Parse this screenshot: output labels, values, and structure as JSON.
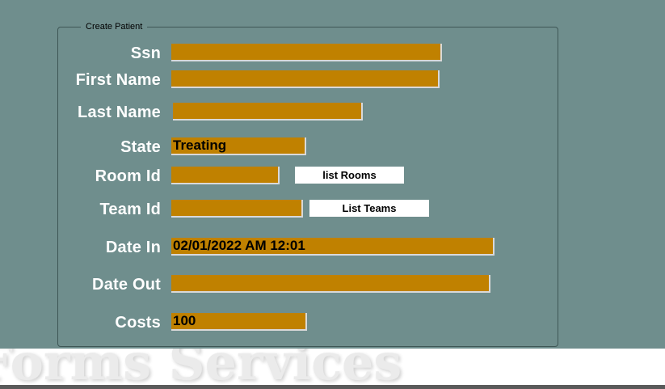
{
  "form": {
    "legend": "Create Patient",
    "fields": {
      "ssn": {
        "label": "Ssn",
        "value": ""
      },
      "first_name": {
        "label": "First Name",
        "value": ""
      },
      "last_name": {
        "label": "Last Name",
        "value": ""
      },
      "state": {
        "label": "State",
        "value": "Treating"
      },
      "room_id": {
        "label": "Room Id",
        "value": ""
      },
      "team_id": {
        "label": "Team Id",
        "value": ""
      },
      "date_in": {
        "label": "Date In",
        "value": "02/01/2022 AM 12:01"
      },
      "date_out": {
        "label": "Date Out",
        "value": ""
      },
      "costs": {
        "label": "Costs",
        "value": "100"
      }
    },
    "buttons": {
      "list_rooms": "list Rooms",
      "list_teams": "List Teams"
    }
  },
  "banner": {
    "text": "Forms Services"
  },
  "colors": {
    "background": "#6f8e8d",
    "field": "#c08100",
    "label": "#ffffff"
  }
}
